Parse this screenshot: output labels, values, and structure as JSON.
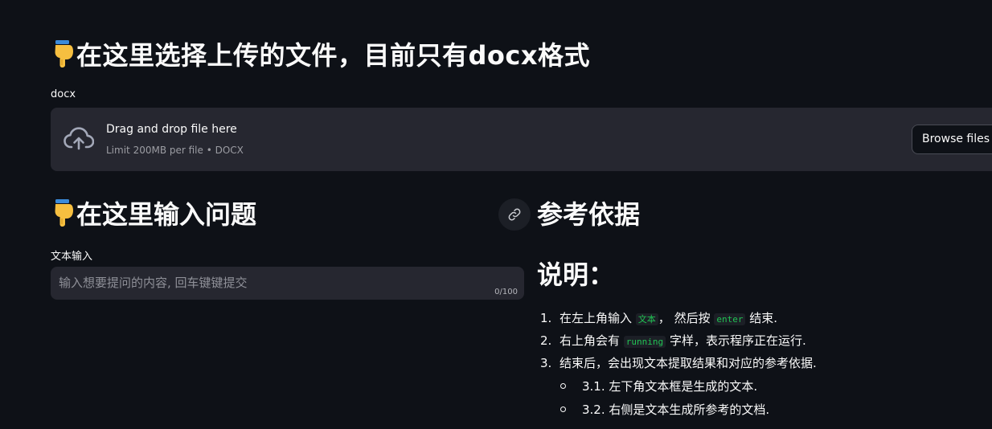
{
  "upload_section": {
    "heading": "在这里选择上传的文件，目前只有docx格式",
    "label": "docx",
    "dropzone_title": "Drag and drop file here",
    "dropzone_limit": "Limit 200MB per file • DOCX",
    "browse_button": "Browse files",
    "icons": [
      "pointing-down-icon",
      "cloud-upload-icon"
    ]
  },
  "question_section": {
    "heading": "在这里输入问题",
    "input_label": "文本输入",
    "input_placeholder": "输入想要提问的内容, 回车键键提交",
    "char_count": "0/100",
    "icons": [
      "pointing-down-icon",
      "link-icon"
    ]
  },
  "reference_section": {
    "heading": "参考依据"
  },
  "instructions": {
    "heading": "说明：",
    "items": [
      {
        "number": "1.",
        "prefix": "在左上角输入",
        "code1": "文本",
        "middle": "， 然后按",
        "code2": "enter",
        "suffix": "结束."
      },
      {
        "number": "2.",
        "prefix": "右上角会有",
        "code": "running",
        "suffix": "字样，表示程序正在运行."
      },
      {
        "number": "3.",
        "text": "结束后，会出现文本提取结果和对应的参考依据."
      }
    ],
    "subitems": [
      "3.1. 左下角文本框是生成的文本.",
      "3.2. 右侧是文本生成所参考的文档."
    ]
  },
  "colors": {
    "background": "#0e1117",
    "surface": "#262730",
    "code_text": "#21c354",
    "text": "#fafafa"
  }
}
